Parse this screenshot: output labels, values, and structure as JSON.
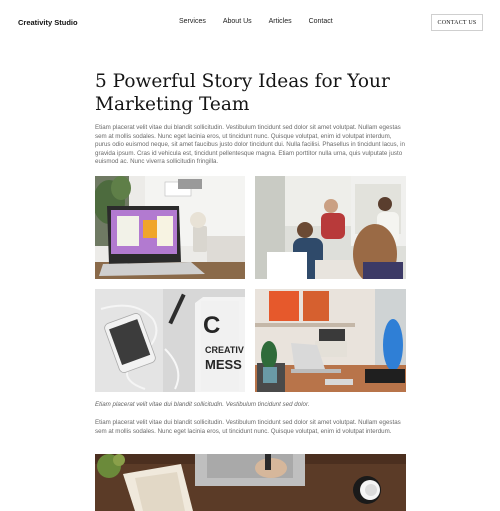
{
  "nav": {
    "brand": "Creativity Studio",
    "links": [
      "Services",
      "About Us",
      "Articles",
      "Contact"
    ],
    "cta": "CONTACT US"
  },
  "article": {
    "title": "5 Powerful Story Ideas for Your Marketing Team",
    "intro": "Etiam placerat velit vitae dui blandit sollicitudin. Vestibulum tincidunt sed dolor sit amet volutpat. Nullam egestas sem at mollis sodales. Nunc eget lacinia eros, ut tincidunt nunc. Quisque volutpat, enim id volutpat interdum, purus odio euismod neque, sit amet faucibus justo dolor tincidunt dui. Nulla facilisi. Phasellus in tincidunt lacus, in gravida ipsum. Cras id vehicula est, tincidunt pellentesque magna. Etiam porttitor nulla urna, quis vulputate justo euismod ac. Nunc viverra sollicitudin fringilla.",
    "caption": "Etiam placerat velit vitae dui blandit sollicitudin. Vestibulum tincidunt sed dolor.",
    "body": "Etiam placerat velit vitae dui blandit sollicitudin. Vestibulum tincidunt sed dolor sit amet volutpat. Nullam egestas sem at mollis sodales. Nunc eget lacinia eros, ut tincidunt nunc. Quisque volutpat, enim id volutpat interdum.",
    "mug_text": "CREATIVE MESS"
  }
}
